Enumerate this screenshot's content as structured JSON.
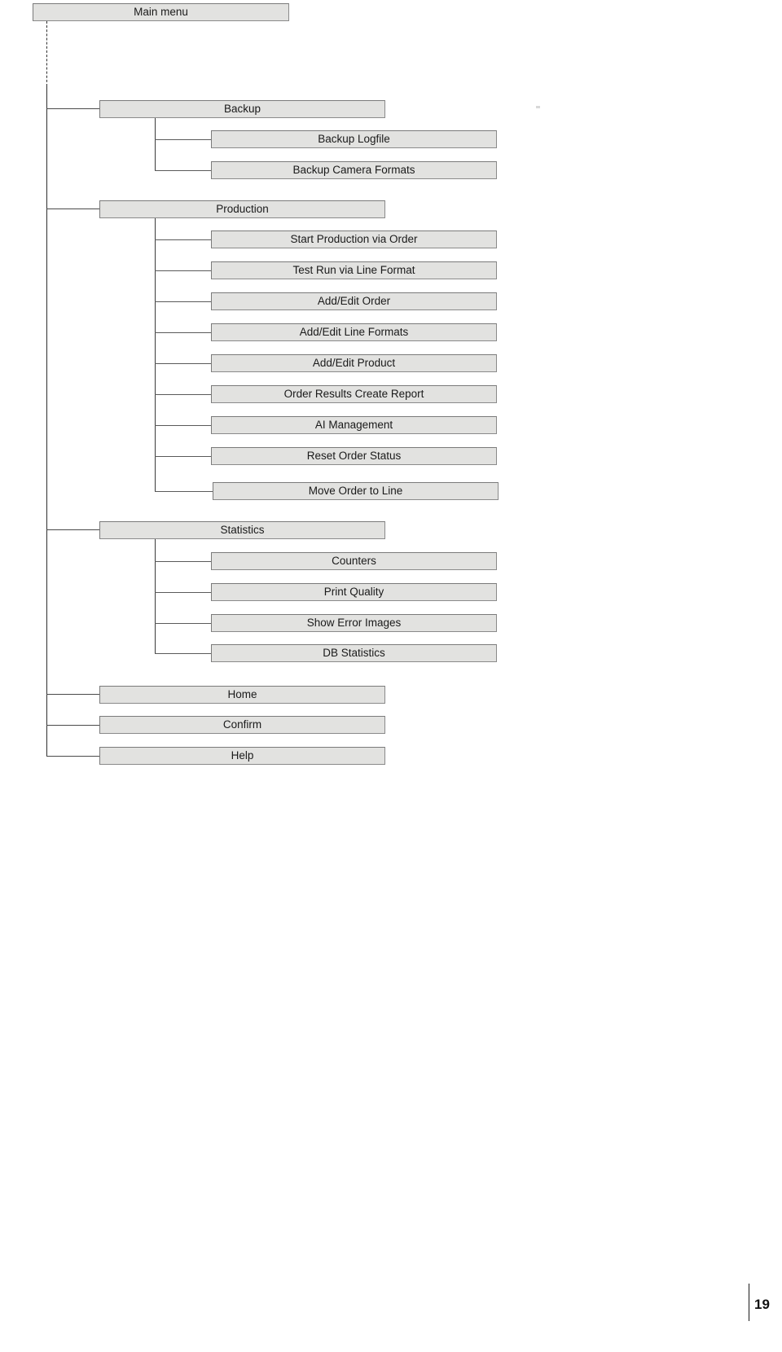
{
  "document": {
    "type": "menu-structure-diagram",
    "page_number": "19"
  },
  "tree": {
    "root": {
      "label": "Main menu",
      "level": 1
    },
    "groups": [
      {
        "parent": "Backup",
        "children": [
          "Backup Logfile",
          "Backup Camera Formats"
        ]
      },
      {
        "parent": "Production",
        "children": [
          "Start Production via Order",
          "Test Run via Line Format",
          "Add/Edit Order",
          "Add/Edit Line Formats",
          "Add/Edit Product",
          "Order Results Create Report",
          "AI Management",
          "Reset Order Status",
          "Move Order to Line"
        ]
      },
      {
        "parent": "Statistics",
        "children": [
          "Counters",
          "Print Quality",
          "Show Error Images",
          "DB Statistics"
        ]
      }
    ],
    "leaf_items": [
      "Home",
      "Confirm",
      "Help"
    ],
    "nodes": {
      "main_menu": "Main menu",
      "backup": "Backup",
      "backup_logfile": "Backup Logfile",
      "backup_camera_formats": "Backup Camera Formats",
      "production": "Production",
      "start_production_via_order": "Start Production via Order",
      "test_run_via_line_format": "Test Run via Line Format",
      "add_edit_order": "Add/Edit Order",
      "add_edit_line_formats": "Add/Edit Line Formats",
      "add_edit_product": "Add/Edit Product",
      "order_results_create_report": "Order Results Create Report",
      "ai_management": "AI Management",
      "reset_order_status": "Reset Order Status",
      "move_order_to_line": "Move Order to Line",
      "statistics": "Statistics",
      "counters": "Counters",
      "print_quality": "Print Quality",
      "show_error_images": "Show Error Images",
      "db_statistics": "DB Statistics",
      "home": "Home",
      "confirm": "Confirm",
      "help": "Help"
    }
  },
  "colors": {
    "node_fill": "#e2e2e0",
    "node_border": "#7a7a7a",
    "line": "#2f2f2f",
    "text": "#1a1a1a",
    "background": "#ffffff"
  }
}
